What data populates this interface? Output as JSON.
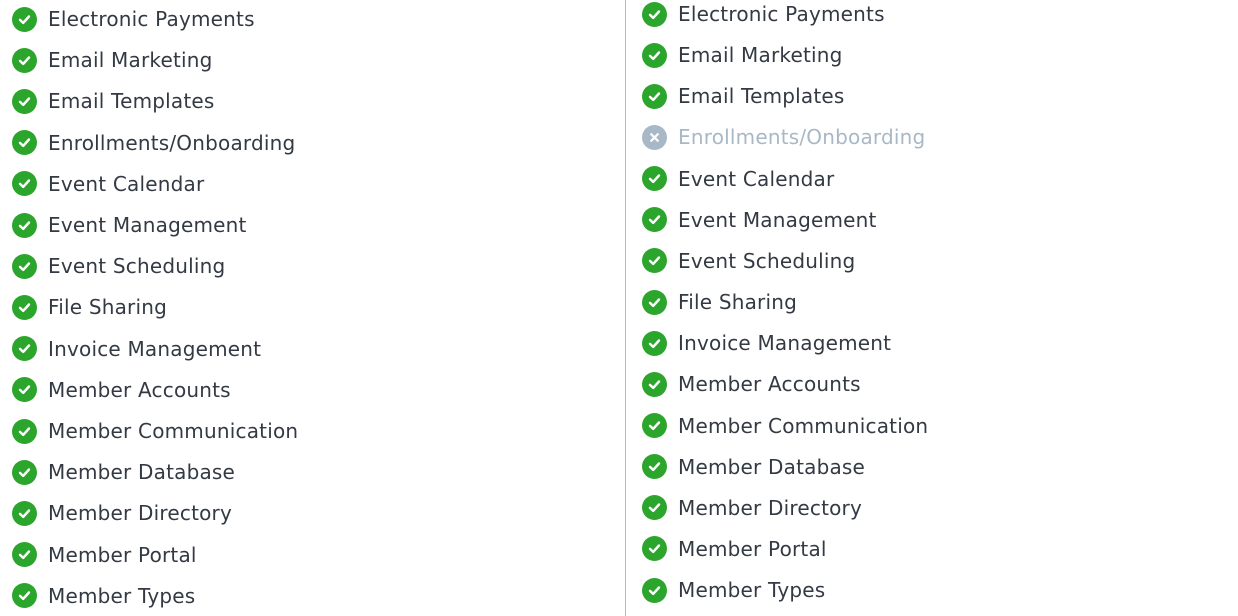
{
  "colors": {
    "included": "#2ba52c",
    "excluded": "#a9b8c6",
    "text": "#333a44",
    "divider": "#a9bccb"
  },
  "left_column": {
    "items": [
      {
        "label": "Electronic Payments",
        "status": "included",
        "icon": "check-circle-icon"
      },
      {
        "label": "Email Marketing",
        "status": "included",
        "icon": "check-circle-icon"
      },
      {
        "label": "Email Templates",
        "status": "included",
        "icon": "check-circle-icon"
      },
      {
        "label": "Enrollments/Onboarding",
        "status": "included",
        "icon": "check-circle-icon"
      },
      {
        "label": "Event Calendar",
        "status": "included",
        "icon": "check-circle-icon"
      },
      {
        "label": "Event Management",
        "status": "included",
        "icon": "check-circle-icon"
      },
      {
        "label": "Event Scheduling",
        "status": "included",
        "icon": "check-circle-icon"
      },
      {
        "label": "File Sharing",
        "status": "included",
        "icon": "check-circle-icon"
      },
      {
        "label": "Invoice Management",
        "status": "included",
        "icon": "check-circle-icon"
      },
      {
        "label": "Member Accounts",
        "status": "included",
        "icon": "check-circle-icon"
      },
      {
        "label": "Member Communication",
        "status": "included",
        "icon": "check-circle-icon"
      },
      {
        "label": "Member Database",
        "status": "included",
        "icon": "check-circle-icon"
      },
      {
        "label": "Member Directory",
        "status": "included",
        "icon": "check-circle-icon"
      },
      {
        "label": "Member Portal",
        "status": "included",
        "icon": "check-circle-icon"
      },
      {
        "label": "Member Types",
        "status": "included",
        "icon": "check-circle-icon"
      }
    ]
  },
  "right_column": {
    "items": [
      {
        "label": "Electronic Payments",
        "status": "included",
        "icon": "check-circle-icon"
      },
      {
        "label": "Email Marketing",
        "status": "included",
        "icon": "check-circle-icon"
      },
      {
        "label": "Email Templates",
        "status": "included",
        "icon": "check-circle-icon"
      },
      {
        "label": "Enrollments/Onboarding",
        "status": "excluded",
        "icon": "x-circle-icon"
      },
      {
        "label": "Event Calendar",
        "status": "included",
        "icon": "check-circle-icon"
      },
      {
        "label": "Event Management",
        "status": "included",
        "icon": "check-circle-icon"
      },
      {
        "label": "Event Scheduling",
        "status": "included",
        "icon": "check-circle-icon"
      },
      {
        "label": "File Sharing",
        "status": "included",
        "icon": "check-circle-icon"
      },
      {
        "label": "Invoice Management",
        "status": "included",
        "icon": "check-circle-icon"
      },
      {
        "label": "Member Accounts",
        "status": "included",
        "icon": "check-circle-icon"
      },
      {
        "label": "Member Communication",
        "status": "included",
        "icon": "check-circle-icon"
      },
      {
        "label": "Member Database",
        "status": "included",
        "icon": "check-circle-icon"
      },
      {
        "label": "Member Directory",
        "status": "included",
        "icon": "check-circle-icon"
      },
      {
        "label": "Member Portal",
        "status": "included",
        "icon": "check-circle-icon"
      },
      {
        "label": "Member Types",
        "status": "included",
        "icon": "check-circle-icon"
      }
    ]
  }
}
